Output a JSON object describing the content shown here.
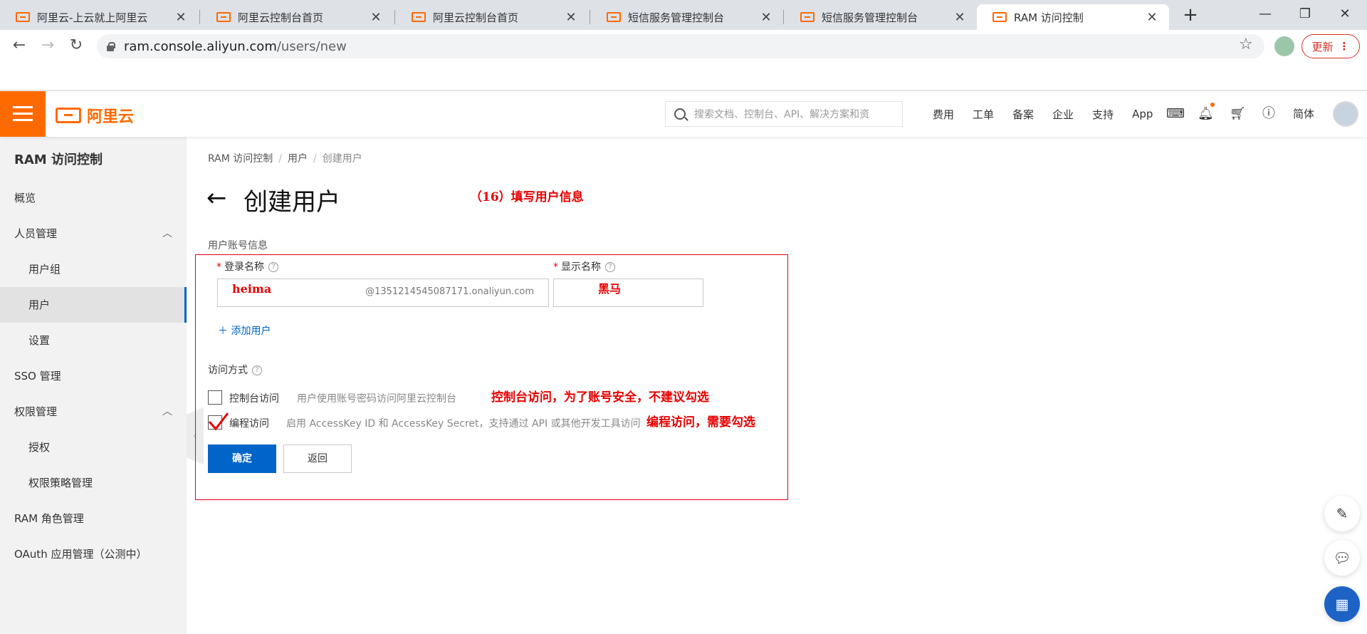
{
  "browser": {
    "tabs": [
      {
        "title": "阿里云-上云就上阿里云",
        "active": false
      },
      {
        "title": "阿里云控制台首页",
        "active": false
      },
      {
        "title": "阿里云控制台首页",
        "active": false
      },
      {
        "title": "短信服务管理控制台",
        "active": false
      },
      {
        "title": "短信服务管理控制台",
        "active": false
      },
      {
        "title": "RAM 访问控制",
        "active": true
      }
    ],
    "new_tab": "+",
    "url_domain": "ram.console.aliyun.com",
    "url_path": "/users/new",
    "update_label": "更新"
  },
  "topnav": {
    "logo_text": "阿里云",
    "search_placeholder": "搜索文档、控制台、API、解决方案和资",
    "links": [
      "费用",
      "工单",
      "备案",
      "企业",
      "支持",
      "App"
    ],
    "language": "简体"
  },
  "sidebar": {
    "title": "RAM 访问控制",
    "items": [
      {
        "label": "概览",
        "sub": false,
        "active": false
      },
      {
        "label": "人员管理",
        "sub": false,
        "active": false,
        "expanded": true
      },
      {
        "label": "用户组",
        "sub": true,
        "active": false
      },
      {
        "label": "用户",
        "sub": true,
        "active": true
      },
      {
        "label": "设置",
        "sub": true,
        "active": false
      },
      {
        "label": "SSO 管理",
        "sub": false,
        "active": false
      },
      {
        "label": "权限管理",
        "sub": false,
        "active": false,
        "expanded": true
      },
      {
        "label": "授权",
        "sub": true,
        "active": false
      },
      {
        "label": "权限策略管理",
        "sub": true,
        "active": false
      },
      {
        "label": "RAM 角色管理",
        "sub": false,
        "active": false
      },
      {
        "label": "OAuth 应用管理（公测中）",
        "sub": false,
        "active": false
      }
    ]
  },
  "main": {
    "breadcrumb": [
      "RAM 访问控制",
      "用户",
      "创建用户"
    ],
    "page_title": "创建用户",
    "annotation_step": "（16）填写用户信息",
    "section_account": "用户账号信息",
    "login_name_label": "登录名称",
    "display_name_label": "显示名称",
    "login_name_value": "heima",
    "login_name_suffix": "@1351214545087171.onaliyun.com",
    "display_name_value": "黑马",
    "add_user_label": "添加用户",
    "section_access": "访问方式",
    "console_access_label": "控制台访问",
    "console_access_desc": "用户使用账号密码访问阿里云控制台",
    "console_access_checked": false,
    "annotation_console": "控制台访问，为了账号安全，不建议勾选",
    "programmatic_access_label": "编程访问",
    "programmatic_access_desc": "启用 AccessKey ID 和 AccessKey Secret，支持通过 API 或其他开发工具访问",
    "programmatic_access_checked": true,
    "annotation_programmatic": "编程访问，需要勾选",
    "confirm_label": "确定",
    "back_label": "返回"
  },
  "colors": {
    "brand": "#ff6a00",
    "primary": "#0064c8",
    "annotation": "#e60000"
  }
}
